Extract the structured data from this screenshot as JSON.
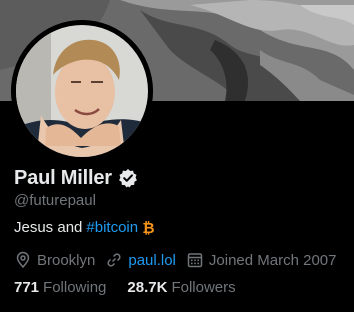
{
  "profile": {
    "display_name": "Paul Miller",
    "handle": "@futurepaul",
    "bio_text": "Jesus and",
    "bio_hashtag": "#bitcoin",
    "location": "Brooklyn",
    "website": "paul.lol",
    "joined": "Joined March 2007",
    "following_count": "771",
    "following_label": "Following",
    "followers_count": "28.7K",
    "followers_label": "Followers"
  },
  "icons": {
    "verified": "verified-badge-icon",
    "bitcoin": "bitcoin-icon",
    "location": "location-pin-icon",
    "link": "link-icon",
    "calendar": "calendar-icon"
  },
  "colors": {
    "background": "#000000",
    "primary_text": "#e7e9ea",
    "secondary_text": "#71767b",
    "link": "#1d9bf0",
    "bitcoin": "#f7931a"
  }
}
